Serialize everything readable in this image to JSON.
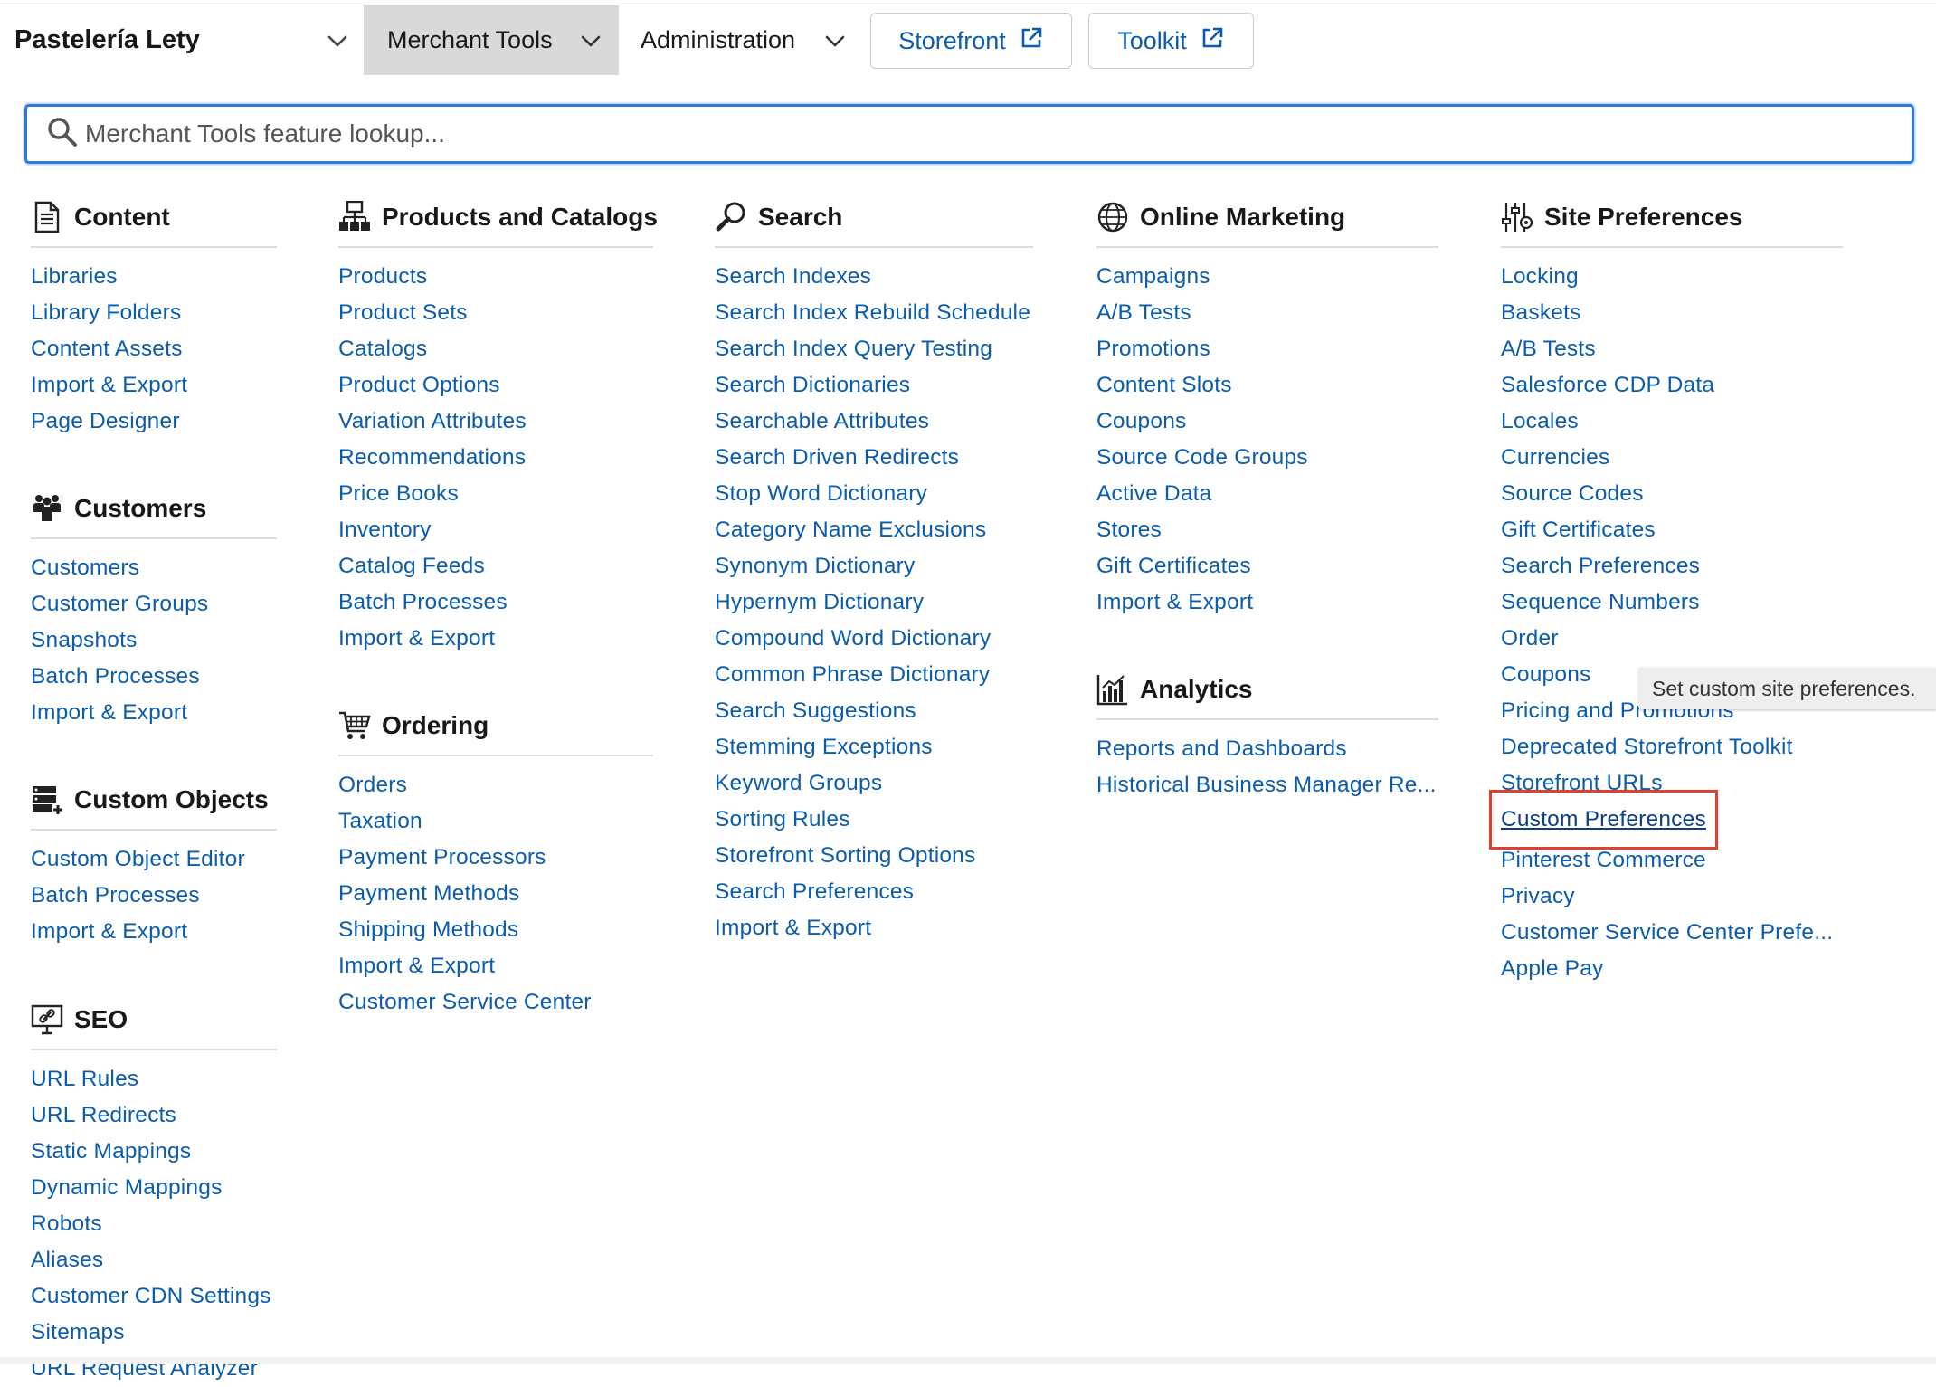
{
  "topbar": {
    "site_name": "Pastelería Lety",
    "menu_merchant": "Merchant Tools",
    "menu_admin": "Administration",
    "storefront": "Storefront",
    "toolkit": "Toolkit"
  },
  "search": {
    "placeholder": "Merchant Tools feature lookup..."
  },
  "tooltip": "Set custom site preferences.",
  "colors": {
    "link": "#0b5cab",
    "highlight_box": "#e0412c",
    "search_border": "#2f7ad9",
    "active_menu_bg": "#d9d9d9"
  },
  "sections": {
    "content": {
      "title": "Content",
      "icon": "document-icon",
      "items": [
        "Libraries",
        "Library Folders",
        "Content Assets",
        "Import & Export",
        "Page Designer"
      ]
    },
    "customers": {
      "title": "Customers",
      "icon": "people-icon",
      "items": [
        "Customers",
        "Customer Groups",
        "Snapshots",
        "Batch Processes",
        "Import & Export"
      ]
    },
    "custom_objects": {
      "title": "Custom Objects",
      "icon": "server-add-icon",
      "items": [
        "Custom Object Editor",
        "Batch Processes",
        "Import & Export"
      ]
    },
    "seo": {
      "title": "SEO",
      "icon": "monitor-link-icon",
      "items": [
        "URL Rules",
        "URL Redirects",
        "Static Mappings",
        "Dynamic Mappings",
        "Robots",
        "Aliases",
        "Customer CDN Settings",
        "Sitemaps",
        "URL Request Analyzer"
      ]
    },
    "products": {
      "title": "Products and Catalogs",
      "icon": "hierarchy-icon",
      "items": [
        "Products",
        "Product Sets",
        "Catalogs",
        "Product Options",
        "Variation Attributes",
        "Recommendations",
        "Price Books",
        "Inventory",
        "Catalog Feeds",
        "Batch Processes",
        "Import & Export"
      ]
    },
    "ordering": {
      "title": "Ordering",
      "icon": "cart-icon",
      "items": [
        "Orders",
        "Taxation",
        "Payment Processors",
        "Payment Methods",
        "Shipping Methods",
        "Import & Export",
        "Customer Service Center"
      ]
    },
    "search": {
      "title": "Search",
      "icon": "magnifier-icon",
      "items": [
        "Search Indexes",
        "Search Index Rebuild Schedule",
        "Search Index Query Testing",
        "Search Dictionaries",
        "Searchable Attributes",
        "Search Driven Redirects",
        "Stop Word Dictionary",
        "Category Name Exclusions",
        "Synonym Dictionary",
        "Hypernym Dictionary",
        "Compound Word Dictionary",
        "Common Phrase Dictionary",
        "Search Suggestions",
        "Stemming Exceptions",
        "Keyword Groups",
        "Sorting Rules",
        "Storefront Sorting Options",
        "Search Preferences",
        "Import & Export"
      ]
    },
    "online_marketing": {
      "title": "Online Marketing",
      "icon": "globe-icon",
      "items": [
        "Campaigns",
        "A/B Tests",
        "Promotions",
        "Content Slots",
        "Coupons",
        "Source Code Groups",
        "Active Data",
        "Stores",
        "Gift Certificates",
        "Import & Export"
      ]
    },
    "analytics": {
      "title": "Analytics",
      "icon": "bar-chart-icon",
      "items": [
        "Reports and Dashboards",
        "Historical Business Manager Re..."
      ]
    },
    "site_prefs": {
      "title": "Site Preferences",
      "icon": "sliders-icon",
      "items": [
        "Locking",
        "Baskets",
        "A/B Tests",
        "Salesforce CDP Data",
        "Locales",
        "Currencies",
        "Source Codes",
        "Gift Certificates",
        "Search Preferences",
        "Sequence Numbers",
        "Order",
        "Coupons",
        "Pricing and Promotions",
        "Deprecated Storefront Toolkit",
        "Storefront URLs",
        "Custom Preferences",
        "Pinterest Commerce",
        "Privacy",
        "Customer Service Center Prefe...",
        "Apple Pay"
      ]
    }
  }
}
